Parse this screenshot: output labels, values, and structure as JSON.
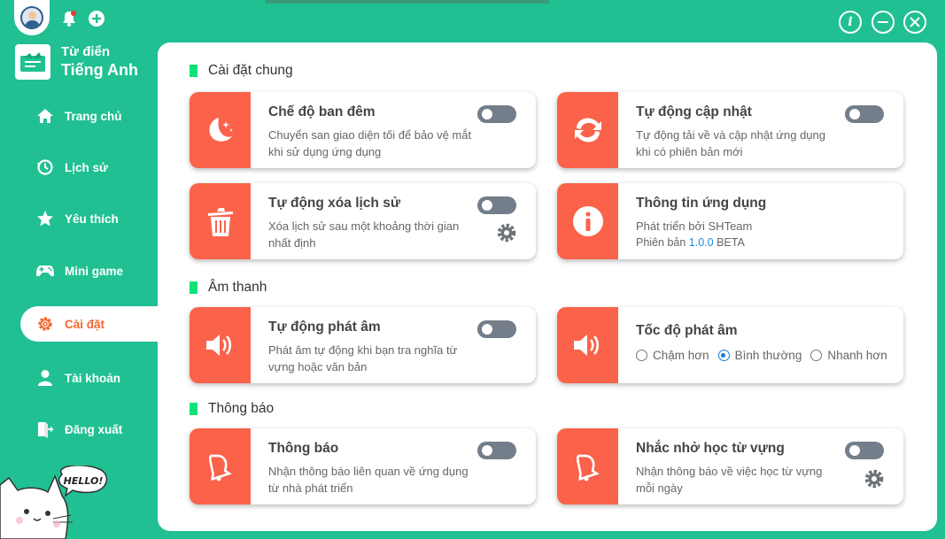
{
  "app": {
    "title_line1": "Từ điển",
    "title_line2": "Tiếng Anh"
  },
  "colors": {
    "brand": "#20c092",
    "accent": "#fa624a",
    "active_nav": "#f2672e",
    "section_mark": "#11e278",
    "toggle_off": "#747d8a",
    "link": "#1a8de0"
  },
  "sidebar": {
    "items": [
      {
        "label": "Trang chủ",
        "icon": "home-icon"
      },
      {
        "label": "Lịch sử",
        "icon": "history-icon"
      },
      {
        "label": "Yêu thích",
        "icon": "star-icon"
      },
      {
        "label": "Mini game",
        "icon": "gamepad-icon"
      },
      {
        "label": "Cài đặt",
        "icon": "gear-icon",
        "active": true
      },
      {
        "label": "Tài khoản",
        "icon": "user-icon"
      },
      {
        "label": "Đăng xuất",
        "icon": "logout-icon"
      }
    ]
  },
  "mascot": {
    "bubble_text": "HELLO!"
  },
  "sections": {
    "general": "Cài đặt chung",
    "sound": "Âm thanh",
    "notify": "Thông báo"
  },
  "cards": {
    "night_mode": {
      "title": "Chế độ ban đêm",
      "desc": "Chuyển san giao diện tối để bảo vệ mắt khi sử dụng ứng dụng",
      "enabled": false
    },
    "auto_update": {
      "title": "Tự động cập nhật",
      "desc": "Tự động tải về và cập nhật ứng dụng khi có phiên bản mới",
      "enabled": false
    },
    "auto_clear": {
      "title": "Tự động xóa lịch sử",
      "desc": "Xóa lịch sử sau một khoảng thời gian nhất định",
      "enabled": false
    },
    "app_info": {
      "title": "Thông tin ứng dụng",
      "developer": "Phát triển bởi SHTeam",
      "version_label": "Phiên bản",
      "version": "1.0.0",
      "version_tag": "BETA"
    },
    "auto_pronounce": {
      "title": "Tự động phát âm",
      "desc": "Phát âm tự động khi bạn tra nghĩa từ vựng hoặc văn bản",
      "enabled": false
    },
    "speed": {
      "title": "Tốc độ phát âm",
      "options": [
        "Chậm hơn",
        "Bình thường",
        "Nhanh hơn"
      ],
      "selected": "Bình thường"
    },
    "notifications": {
      "title": "Thông báo",
      "desc": "Nhận thông báo liên quan về ứng dụng từ nhà phát triển",
      "enabled": false
    },
    "reminder": {
      "title": "Nhắc nhở học từ vựng",
      "desc": "Nhận thông báo về việc học từ vựng mỗi ngày",
      "enabled": false
    }
  }
}
